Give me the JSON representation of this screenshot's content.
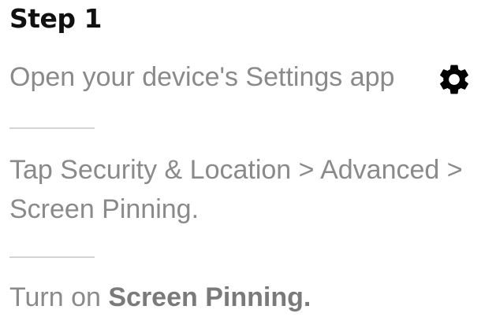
{
  "step": {
    "title": "Step 1"
  },
  "instructions": {
    "open_settings": "Open your device's Settings app",
    "tap_path_line1": "Tap Security & Location > Advanced >",
    "tap_path_line2": "Screen Pinning.",
    "turn_on_prefix": "Turn on ",
    "turn_on_bold": "Screen Pinning."
  },
  "icons": {
    "settings": "gear-icon"
  },
  "colors": {
    "title": "#111111",
    "body_text": "#8a8a8a",
    "divider": "#d4d4d4",
    "icon": "#000000"
  }
}
